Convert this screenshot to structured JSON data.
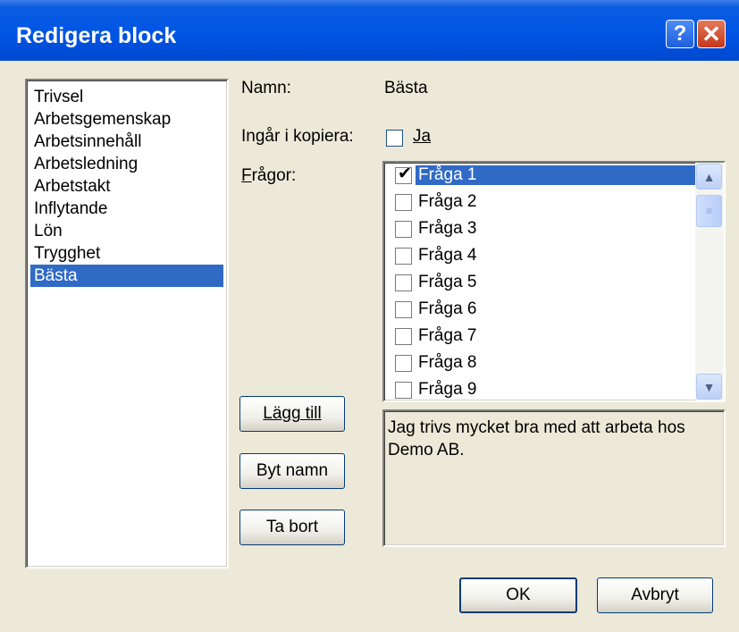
{
  "window": {
    "title": "Redigera block",
    "help_label": "?",
    "close_label": "✕"
  },
  "blocks": {
    "items": [
      "Trivsel",
      "Arbetsgemenskap",
      "Arbetsinnehåll",
      "Arbetsledning",
      "Arbetstakt",
      "Inflytande",
      "Lön",
      "Trygghet",
      "Bästa"
    ],
    "selected": "Bästa"
  },
  "form": {
    "name_label": "Namn:",
    "name_value": "Bästa",
    "copy_label": "Ingår i kopiera:",
    "copy_checkbox_label": "Ja",
    "copy_checked": false,
    "questions_label": "Frågor:"
  },
  "questions": {
    "items": [
      "Fråga 1",
      "Fråga 2",
      "Fråga 3",
      "Fråga 4",
      "Fråga 5",
      "Fråga 6",
      "Fråga 7",
      "Fråga 8",
      "Fråga 9"
    ],
    "checked": [
      true,
      false,
      false,
      false,
      false,
      false,
      false,
      false,
      false
    ],
    "selected": "Fråga 1"
  },
  "description": "Jag trivs mycket bra med att arbeta hos Demo AB.",
  "buttons": {
    "add": "Lägg till",
    "rename": "Byt namn",
    "remove": "Ta bort",
    "ok": "OK",
    "cancel": "Avbryt"
  },
  "icons": {
    "scroll_up": "chevron-up-icon",
    "scroll_down": "chevron-down-icon",
    "check": "checkmark-icon"
  }
}
